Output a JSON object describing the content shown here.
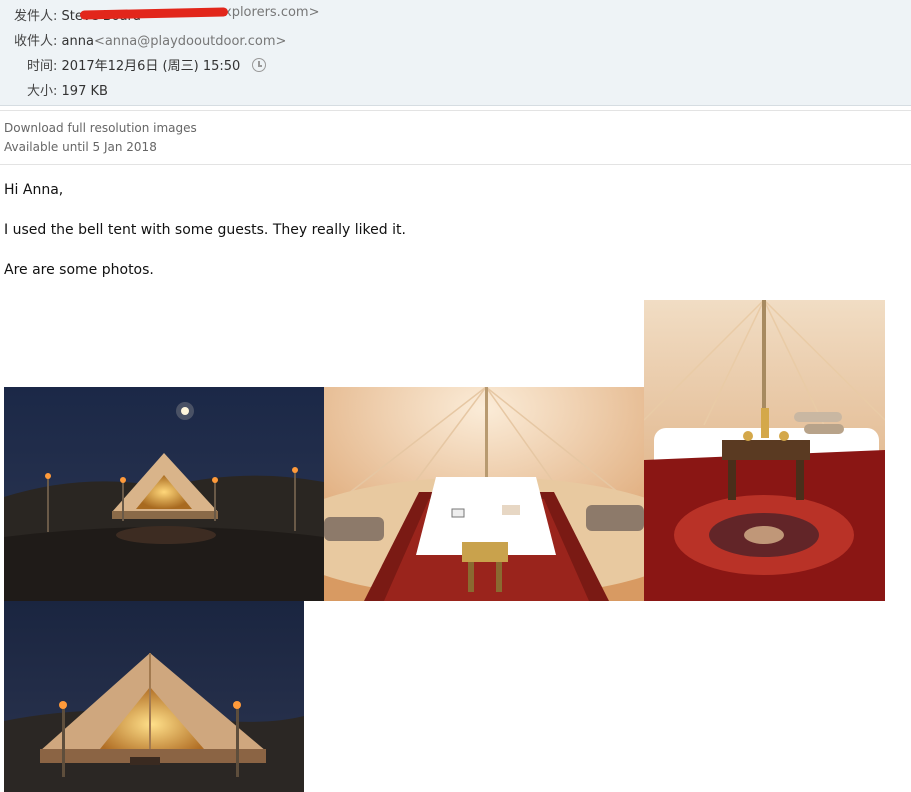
{
  "header": {
    "from_label": "发件人:",
    "from_name": "Steve Board",
    "from_addr": "<steve@desertexplorers.com>",
    "from_addr_visible": "xplorers.com>",
    "to_label": "收件人:",
    "to_name": "anna",
    "to_addr": "<anna@playdooutdoor.com>",
    "time_label": "时间:",
    "time_value": "2017年12月6日 (周三) 15:50",
    "size_label": "大小:",
    "size_value": "197 KB"
  },
  "attachments": {
    "download_link": "Download full resolution images",
    "available_until": "Available until 5 Jan 2018"
  },
  "message": {
    "greeting": "Hi Anna,",
    "line1": "I used the bell tent with some guests.  They really liked it.",
    "line2": "Are are some photos."
  },
  "photos": [
    {
      "name": "night-desert-tent-photo"
    },
    {
      "name": "tent-interior-bed-photo"
    },
    {
      "name": "tent-interior-rug-photo"
    },
    {
      "name": "night-tent-closeup-photo"
    }
  ]
}
